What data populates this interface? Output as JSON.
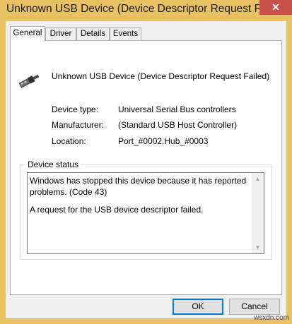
{
  "window": {
    "title": "Unknown USB Device (Device Descriptor Request Faile",
    "close_glyph": "✕",
    "frame_color": "#e8c262",
    "close_color": "#c7504a"
  },
  "tabs": [
    "General",
    "Driver",
    "Details",
    "Events"
  ],
  "general": {
    "device_name": "Unknown USB Device (Device Descriptor Request Failed)",
    "device_icon": "usb-plug-icon",
    "properties": [
      {
        "label": "Device type:",
        "value": "Universal Serial Bus controllers"
      },
      {
        "label": "Manufacturer:",
        "value": "(Standard USB Host Controller)"
      },
      {
        "label": "Location:",
        "value": "Port_#0002.Hub_#0003"
      }
    ],
    "status_group_label": "Device status",
    "status_lines": [
      "Windows has stopped this device because it has reported problems. (Code 43)",
      "A request for the USB device descriptor failed."
    ]
  },
  "buttons": {
    "ok": "OK",
    "cancel": "Cancel"
  },
  "watermark": "wsxdn.com"
}
